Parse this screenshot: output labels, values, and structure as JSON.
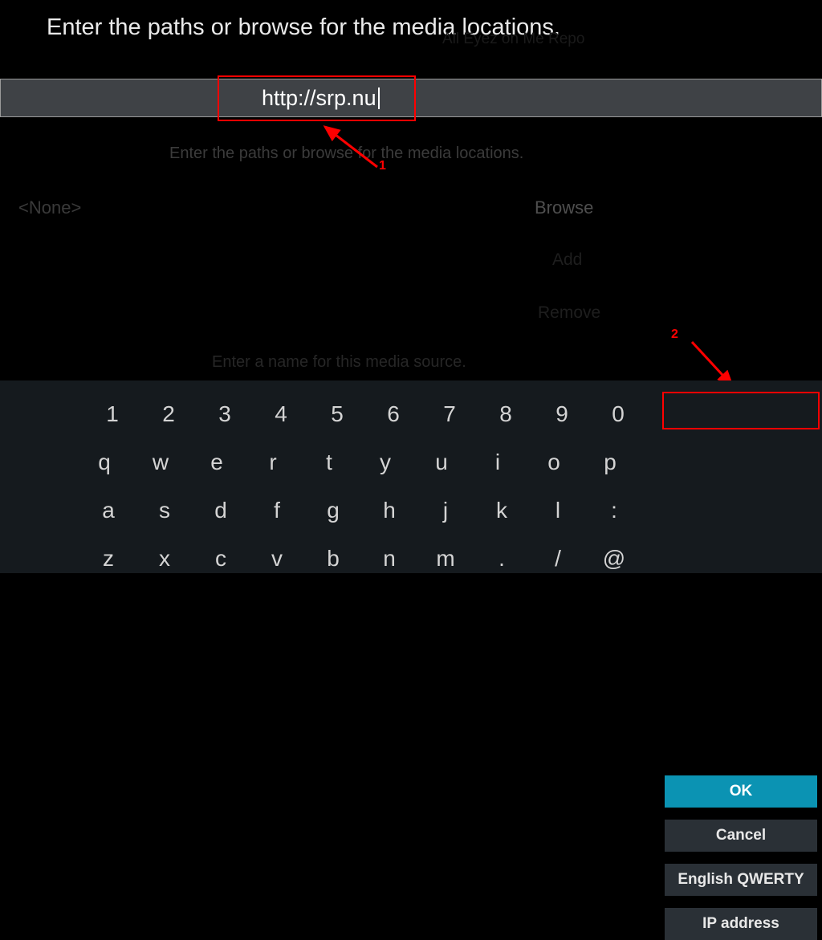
{
  "dialog": {
    "title": "Enter the paths or browse for the media locations.",
    "input_value": "http://srp.nu",
    "faded_title": "Enter the paths or browse for the media locations.",
    "none_text": "<None>",
    "browse_label": "Browse",
    "add_label": "Add",
    "remove_label": "Remove",
    "name_label": "Enter a name for this media source.",
    "background_repo": "All Eyez on Me Repo"
  },
  "keyboard": {
    "row1": [
      "1",
      "2",
      "3",
      "4",
      "5",
      "6",
      "7",
      "8",
      "9",
      "0"
    ],
    "row2": [
      "q",
      "w",
      "e",
      "r",
      "t",
      "y",
      "u",
      "i",
      "o",
      "p"
    ],
    "row3": [
      "a",
      "s",
      "d",
      "f",
      "g",
      "h",
      "j",
      "k",
      "l",
      ":"
    ],
    "row4": [
      "z",
      "x",
      "c",
      "v",
      "b",
      "n",
      "m",
      ".",
      "/",
      "@"
    ]
  },
  "actions": {
    "ok": "OK",
    "cancel": "Cancel",
    "layout": "English QWERTY",
    "ip": "IP address"
  },
  "annotations": {
    "n1": "1",
    "n2": "2"
  }
}
